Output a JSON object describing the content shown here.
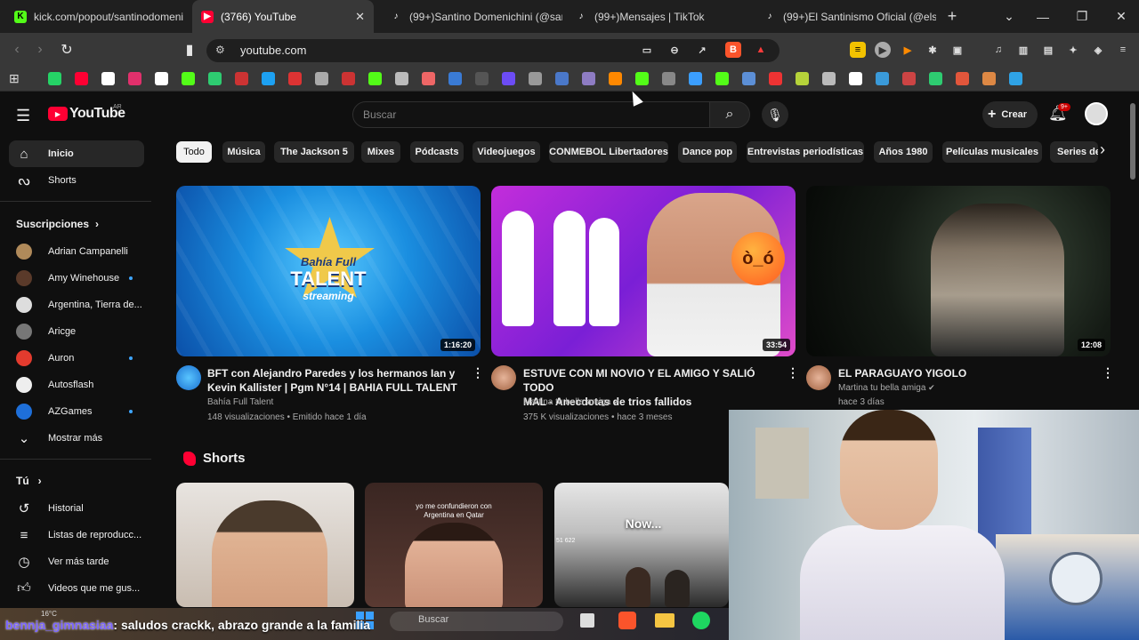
{
  "tabs": [
    {
      "title": "kick.com/popout/santinodomeni",
      "favicon": "kick-icon",
      "color": "#53fc18"
    },
    {
      "title": "(3766) YouTube",
      "favicon": "youtube-icon",
      "color": "#ff0033"
    },
    {
      "title": "(99+)Santino Domenichini (@san",
      "favicon": "tiktok-icon",
      "color": "#ffffff"
    },
    {
      "title": "(99+)Mensajes | TikTok",
      "favicon": "tiktok-icon",
      "color": "#ffffff"
    },
    {
      "title": "(99+)El Santinismo Oficial (@els",
      "favicon": "tiktok-icon",
      "color": "#ffffff"
    }
  ],
  "address": {
    "url": "youtube.com"
  },
  "youtube": {
    "logo_text": "YouTube",
    "country_code": "AR",
    "search_placeholder": "Buscar",
    "create_label": "Crear",
    "notif_badge": "9+",
    "sidebar": {
      "main": [
        {
          "label": "Inicio",
          "icon": "home-icon"
        },
        {
          "label": "Shorts",
          "icon": "shorts-icon"
        }
      ],
      "subs_header": "Suscripciones",
      "subs": [
        {
          "label": "Adrian Campanelli",
          "dot": false,
          "color": "#b08a5a"
        },
        {
          "label": "Amy Winehouse",
          "dot": true,
          "color": "#5a3a2a"
        },
        {
          "label": "Argentina, Tierra de...",
          "dot": false,
          "color": "#dddddd"
        },
        {
          "label": "Aricge",
          "dot": false,
          "color": "#777777"
        },
        {
          "label": "Auron",
          "dot": true,
          "color": "#e33b2e"
        },
        {
          "label": "Autosflash",
          "dot": false,
          "color": "#eeeeee"
        },
        {
          "label": "AZGames",
          "dot": true,
          "color": "#1e6fd9"
        }
      ],
      "show_more": "Mostrar más",
      "you_header": "Tú",
      "you": [
        {
          "label": "Historial",
          "icon": "history-icon"
        },
        {
          "label": "Listas de reproducc...",
          "icon": "playlist-icon"
        },
        {
          "label": "Ver más tarde",
          "icon": "watch-later-icon"
        },
        {
          "label": "Videos que me gus...",
          "icon": "like-icon"
        }
      ]
    },
    "chips": [
      "Todo",
      "Música",
      "The Jackson 5",
      "Mixes",
      "Pódcasts",
      "Videojuegos",
      "CONMEBOL Libertadores",
      "Dance pop",
      "Entrevistas periodísticas",
      "Años 1980",
      "Películas musicales",
      "Series de"
    ],
    "videos": [
      {
        "title_line1": "BFT con Alejandro Paredes y los hermanos Ian y",
        "title_line2": "Kevin Kallister | Pgm N°14 | BAHIA FULL TALENT",
        "channel": "Bahía Full Talent",
        "meta": "148 visualizaciones • Emitido hace 1 día",
        "duration": "1:16:20",
        "thumb_text_1": "Bahía Full",
        "thumb_text_2": "TALENT",
        "thumb_text_3": "streaming",
        "verified": false
      },
      {
        "title_line1": "ESTUVE CON MI NOVIO Y EL AMIGO Y SALIÓ TODO",
        "title_line2": "MAL - Anecdotas de trios fallidos",
        "channel": "Martina tu bella amiga",
        "meta": "375 K visualizaciones • hace 3 meses",
        "duration": "33:54",
        "verified": true
      },
      {
        "title_line1": "EL PARAGUAYO YIGOLO",
        "title_line2": "",
        "channel": "Martina tu bella amiga",
        "meta": "hace 3 días",
        "duration": "12:08",
        "verified": true
      }
    ],
    "shorts_header": "Shorts",
    "shorts": [
      {
        "caption": ""
      },
      {
        "caption": "yo me confundieron con Argentina en Qatar"
      },
      {
        "caption": "Now...",
        "corner": "51 622"
      }
    ]
  },
  "stream": {
    "chat_user": "bennja_gimnasiaa",
    "chat_message": ": saludos crackk, abrazo grande a la familia",
    "taskbar_search": "Buscar",
    "temperature": "16°C"
  }
}
